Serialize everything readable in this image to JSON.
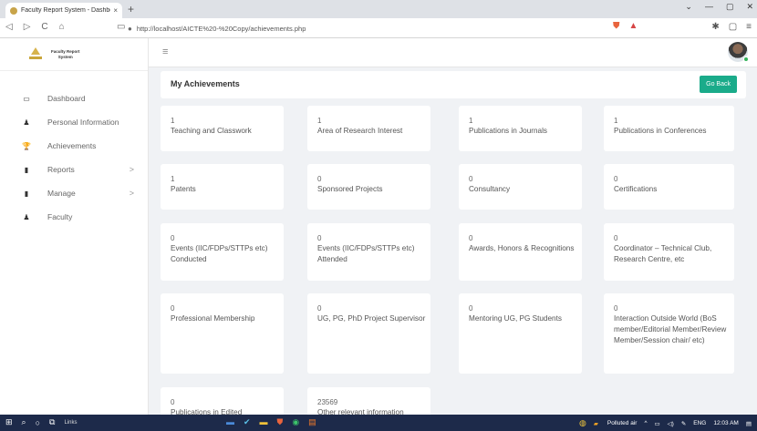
{
  "browser": {
    "tab_title": "Faculty Report System - Dashboo",
    "tab_close": "×",
    "new_tab": "+",
    "url": "http://localhost/AICTE%20-%20Copy/achievements.php",
    "nav_back": "◁",
    "nav_forward": "▷",
    "nav_reload": "C",
    "nav_home": "⌂"
  },
  "brand": {
    "line1": "Faculty Report",
    "line2": "System"
  },
  "sidebar": {
    "items": [
      {
        "label": "Dashboard",
        "icon": "monitor-icon",
        "glyph": "▭"
      },
      {
        "label": "Personal Information",
        "icon": "user-icon",
        "glyph": "♟"
      },
      {
        "label": "Achievements",
        "icon": "trophy-icon",
        "glyph": "🏆"
      },
      {
        "label": "Reports",
        "icon": "file-icon",
        "glyph": "▮",
        "chevron": ">"
      },
      {
        "label": "Manage",
        "icon": "file-icon",
        "glyph": "▮",
        "chevron": ">"
      },
      {
        "label": "Faculty",
        "icon": "user-icon",
        "glyph": "♟"
      }
    ]
  },
  "page": {
    "title": "My Achievements",
    "go_back": "Go Back"
  },
  "cards": [
    {
      "value": "1",
      "label": "Teaching and Classwork"
    },
    {
      "value": "1",
      "label": "Area of Research Interest"
    },
    {
      "value": "1",
      "label": "Publications in Journals"
    },
    {
      "value": "1",
      "label": "Publications in Conferences"
    },
    {
      "value": "1",
      "label": "Patents"
    },
    {
      "value": "0",
      "label": "Sponsored Projects"
    },
    {
      "value": "0",
      "label": "Consultancy"
    },
    {
      "value": "0",
      "label": "Certifications"
    },
    {
      "value": "0",
      "label": "Events (IIC/FDPs/STTPs etc) Conducted"
    },
    {
      "value": "0",
      "label": "Events (IIC/FDPs/STTPs etc) Attended"
    },
    {
      "value": "0",
      "label": "Awards, Honors & Recognitions"
    },
    {
      "value": "0",
      "label": "Coordinator – Technical Club, Research Centre, etc"
    },
    {
      "value": "0",
      "label": "Professional Membership"
    },
    {
      "value": "0",
      "label": "UG, PG, PhD Project Supervisor"
    },
    {
      "value": "0",
      "label": "Mentoring UG, PG Students"
    },
    {
      "value": "0",
      "label": "Interaction Outside World (BoS member/Editorial Member/Review Member/Session chair/ etc)"
    },
    {
      "value": "0",
      "label": "Publications in Edited"
    },
    {
      "value": "23569",
      "label": "Other relevant information"
    }
  ],
  "taskbar": {
    "links": "Links",
    "weather": "Polluted air",
    "lang": "ENG",
    "time": "12:03 AM"
  }
}
